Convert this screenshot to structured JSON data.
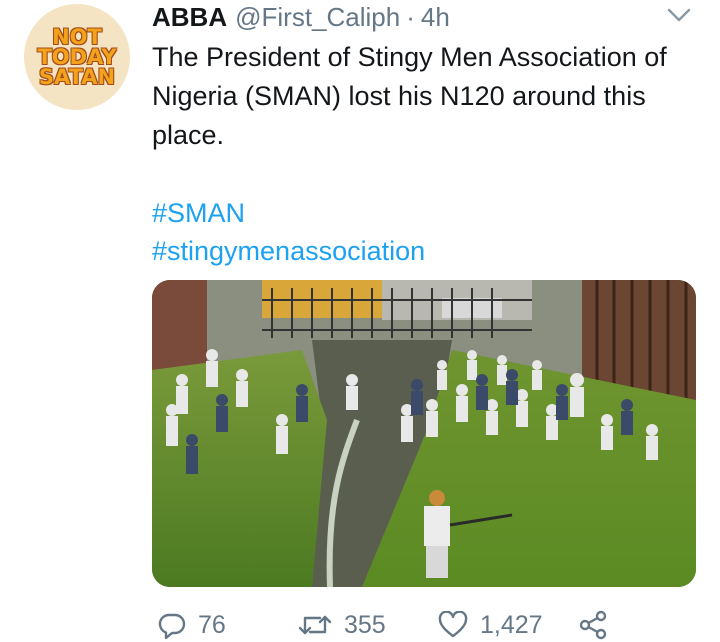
{
  "tweet": {
    "author": {
      "name": "ABBA",
      "handle": "@First_Caliph",
      "time": "4h",
      "separator": "·",
      "avatar_text": [
        "NOT",
        "TODAY",
        "SATAN"
      ]
    },
    "text": "The President of Stingy Men Association of Nigeria (SMAN) lost his N120 around this place.",
    "hashtags": [
      "#SMAN",
      "#stingymenassociation"
    ],
    "media": {
      "description": "Crowd of people searching through grass along a drainage canal"
    },
    "actions": {
      "reply": {
        "icon": "reply-icon",
        "count": "76"
      },
      "retweet": {
        "icon": "retweet-icon",
        "count": "355"
      },
      "like": {
        "icon": "heart-icon",
        "count": "1,427"
      },
      "share": {
        "icon": "share-icon"
      }
    },
    "colors": {
      "text": "#14171a",
      "secondary": "#657786",
      "link": "#1da1f2"
    }
  }
}
